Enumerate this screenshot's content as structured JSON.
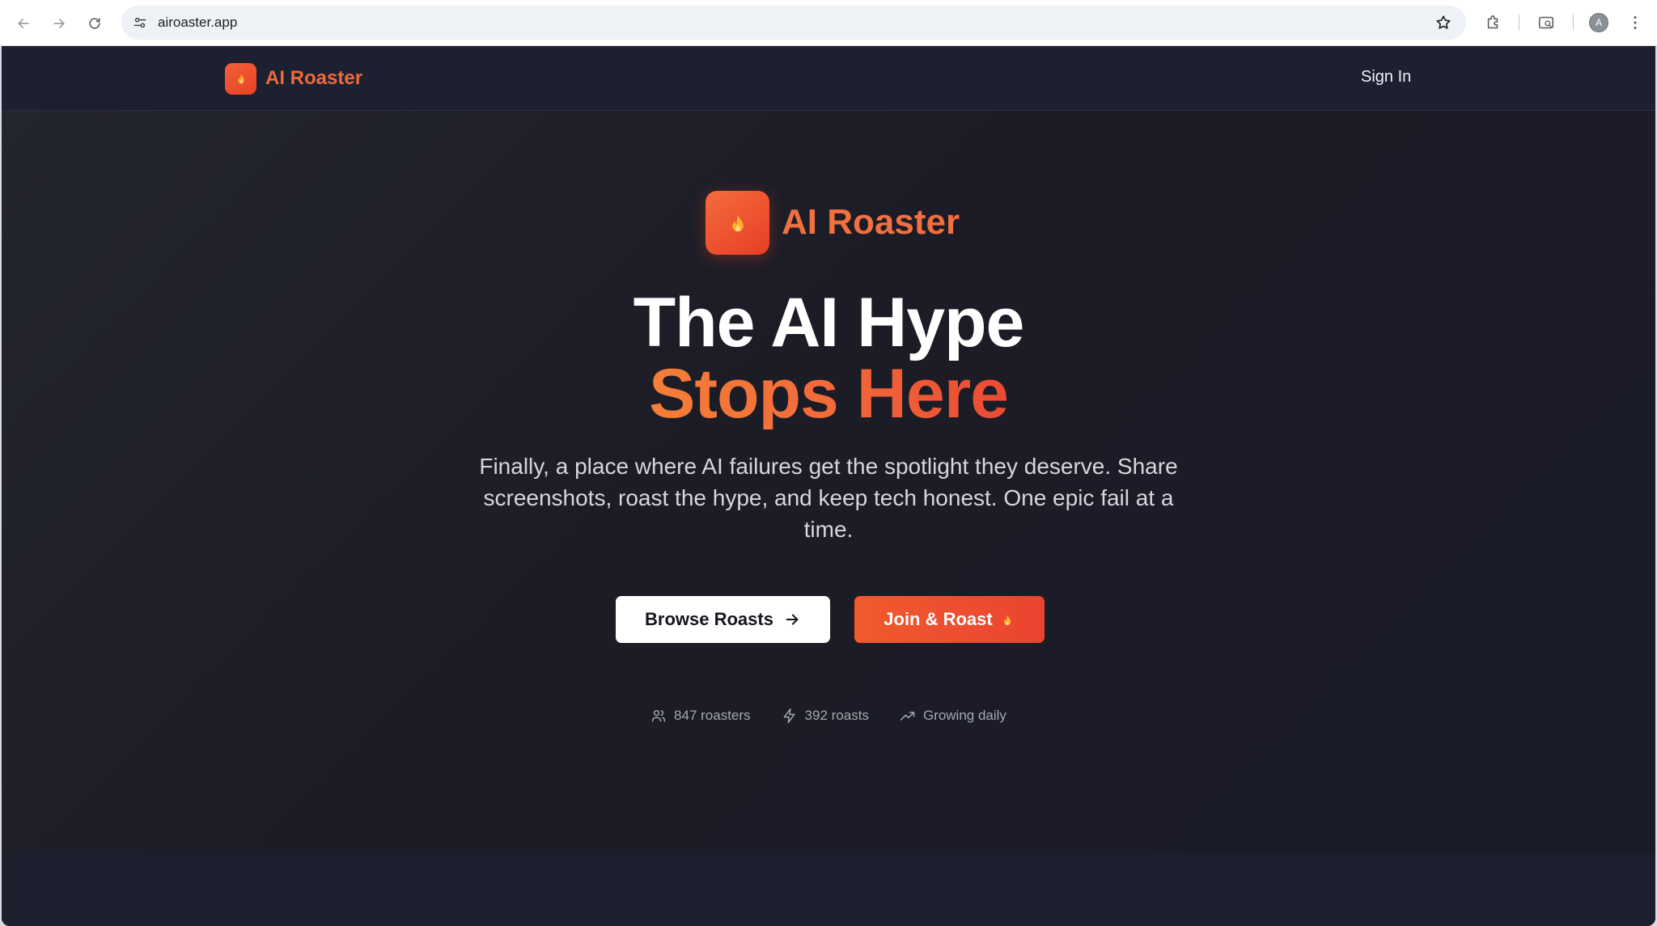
{
  "browser": {
    "url": "airoaster.app",
    "profile_initial": "A"
  },
  "header": {
    "brand": "AI Roaster",
    "sign_in": "Sign In"
  },
  "hero": {
    "brand": "AI Roaster",
    "headline_line1": "The AI Hype",
    "headline_line2": "Stops Here",
    "subtitle": "Finally, a place where AI failures get the spotlight they deserve. Share screenshots, roast the hype, and keep tech honest. One epic fail at a time.",
    "browse_button": "Browse Roasts",
    "join_button": "Join & Roast",
    "stats": [
      {
        "icon": "users-icon",
        "label": "847 roasters"
      },
      {
        "icon": "zap-icon",
        "label": "392 roasts"
      },
      {
        "icon": "trending-up-icon",
        "label": "Growing daily"
      }
    ]
  },
  "colors": {
    "accent_orange": "#f0683c",
    "accent_red": "#ea4430",
    "background": "#1c1c26"
  }
}
